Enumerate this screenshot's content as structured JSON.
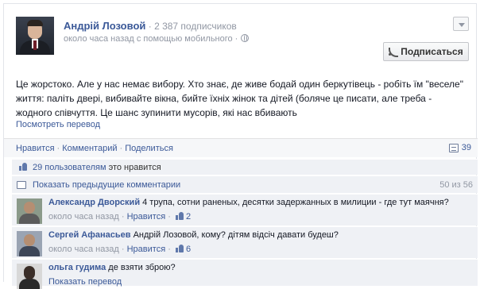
{
  "post": {
    "author": "Андрій Лозовой",
    "separator": "·",
    "subscribers": "2 387 подписчиков",
    "meta": "около часа назад с помощью мобильного ·",
    "subscribe_label": "Подписаться",
    "text": "Це жорстоко. Але у нас немає вибору. Хто знає, де живе бодай один беркутівець - робіть їм \"веселе\" життя: паліть двері, вибивайте вікна, бийте їхніх жінок та дітей (боляче це писати, але треба - жодного співчуття. Це шанс зупинити мусорів, які нас вбивають",
    "translate": "Посмотреть перевод"
  },
  "actions": {
    "like": "Нравится",
    "comment": "Комментарий",
    "share": "Поделиться",
    "comment_count": "39"
  },
  "likes": {
    "count_text": "29 пользователям",
    "suffix": " это нравится"
  },
  "previous": {
    "label": "Показать предыдущие комментарии",
    "pager": "50 из 56"
  },
  "comments": [
    {
      "name": "Александр Дворский",
      "text": " 4 трупа, сотни раненых, десятки задержанных в милиции - где тут маячня?",
      "time": "около часа назад",
      "like": "Нравится",
      "likes": "2"
    },
    {
      "name": "Сергей Афанасьев",
      "text": " Андрій Лозовой, кому? дітям відсіч давати будеш?",
      "time": "около часа назад",
      "like": "Нравится",
      "likes": "6"
    },
    {
      "name": "ольга гудима",
      "text": " де взяти зброю?",
      "translate": "Показать перевод"
    }
  ],
  "icons": [
    "chevron-down-icon",
    "rss-icon",
    "globe-icon",
    "comment-icon",
    "thumbs-up-icon"
  ]
}
